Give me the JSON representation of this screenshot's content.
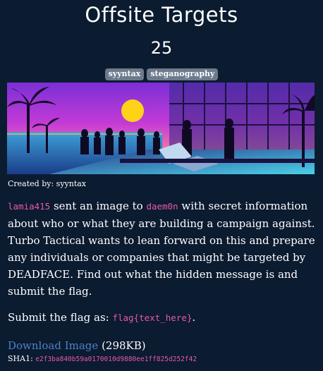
{
  "challenge": {
    "title": "Offsite Targets",
    "points": "25",
    "tags": [
      "syyntax",
      "steganography"
    ],
    "author_label": "Created by: syyntax",
    "description": {
      "part1_user": "lamia415",
      "part2": " sent an image to ",
      "part3_user": "daem0n",
      "part4": " with secret information about who or what they are building a campaign against. Turbo Tactical wants to lean forward on this and prepare any individuals or companies that might be targeted by DEADFACE. Find out what the hidden message is and submit the flag."
    },
    "submit": {
      "prefix": "Submit the flag as: ",
      "format": "flag{text_here}",
      "suffix": "."
    },
    "download": {
      "link_label": "Download Image",
      "size": "(298KB)"
    },
    "sha1": {
      "label": "SHA1:",
      "hash": "e2f3ba840b59a0170010d9880ee1ff825d252f42"
    }
  },
  "colors": {
    "background": "#0b1b30",
    "tag_bg": "#6c7a8c",
    "code": "#e75aa4",
    "link": "#4c84c4"
  }
}
